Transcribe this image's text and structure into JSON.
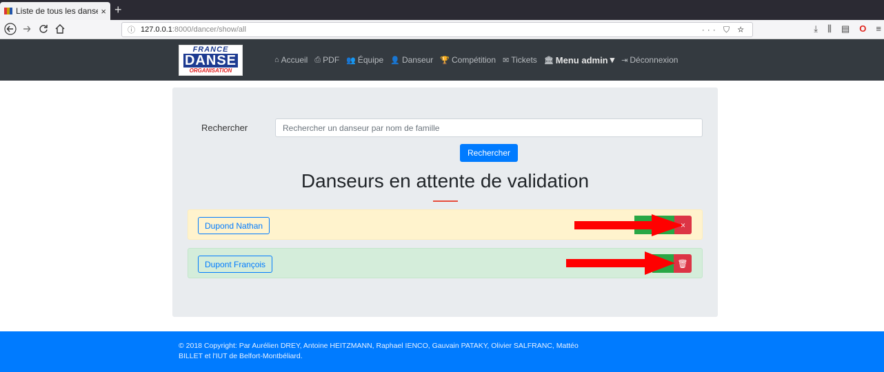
{
  "browser": {
    "tab_title": "Liste de tous les danseurs",
    "tab_close": "×",
    "new_tab": "+",
    "url_host": "127.0.0.1",
    "url_path": ":8000/dancer/show/all",
    "url_info": "ⓘ",
    "url_actions": "··· ⛉ ☆"
  },
  "logo": {
    "line1": "FRANCE",
    "line2": "DANSE",
    "line3": "ORGANISATION"
  },
  "menu": {
    "items": [
      {
        "icon": "⌂",
        "label": "Accueil"
      },
      {
        "icon": "⎙",
        "label": "PDF"
      },
      {
        "icon": "👥",
        "label": "Équipe"
      },
      {
        "icon": "👤",
        "label": "Danseur"
      },
      {
        "icon": "🏆",
        "label": "Compétition"
      },
      {
        "icon": "✉",
        "label": "Tickets"
      }
    ],
    "admin": {
      "icon": "🏛",
      "label": "Menu admin",
      "caret": "▾"
    },
    "logout": {
      "icon": "⇥",
      "label": "Déconnexion"
    }
  },
  "search": {
    "label": "Rechercher",
    "placeholder": "Rechercher un danseur par nom de famille",
    "button": "Rechercher"
  },
  "section_title": "Danseurs en attente de validation",
  "dancers": [
    {
      "name": "Dupond Nathan",
      "status": "pending",
      "delete_icon": "×"
    },
    {
      "name": "Dupont François",
      "status": "ok",
      "delete_icon": "🗑"
    }
  ],
  "footer": {
    "text": "© 2018 Copyright: Par Aurélien DREY, Antoine HEITZMANN, Raphael IENCO, Gauvain PATAKY, Olivier SALFRANC, Mattéo BILLET et l'IUT de Belfort-Montbéliard."
  },
  "colors": {
    "primary": "#007bff",
    "success": "#28a745",
    "danger": "#dc3545",
    "header": "#343a40",
    "arrow": "#ff0000"
  }
}
